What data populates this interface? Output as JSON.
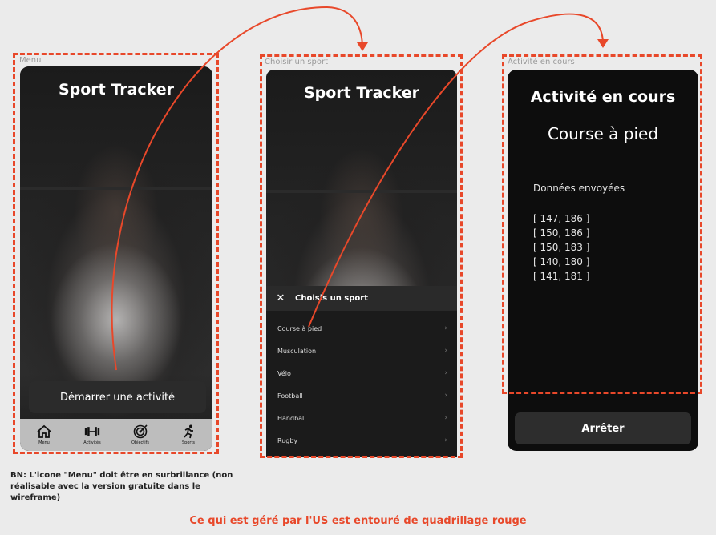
{
  "frames": {
    "menu": "Menu",
    "choose": "Choisir un sport",
    "activity": "Activité en cours"
  },
  "menu_screen": {
    "app_title": "Sport Tracker",
    "start_button": "Démarrer une activité",
    "tabs": [
      {
        "label": "Menu",
        "icon": "home-icon"
      },
      {
        "label": "Activités",
        "icon": "dumbbell-icon"
      },
      {
        "label": "Objectifs",
        "icon": "target-icon"
      },
      {
        "label": "Sports",
        "icon": "runner-icon"
      }
    ]
  },
  "choose_screen": {
    "app_title": "Sport Tracker",
    "sheet_title": "Choisis un sport",
    "close_icon": "close-icon",
    "sports": [
      "Course à pied",
      "Musculation",
      "Vélo",
      "Football",
      "Handball",
      "Rugby"
    ]
  },
  "activity_screen": {
    "title": "Activité en cours",
    "sport": "Course à pied",
    "data_label": "Données envoyées",
    "data_points": [
      "[ 147, 186 ]",
      "[ 150, 186 ]",
      "[ 150, 183 ]",
      "[ 140, 180 ]",
      "[ 141, 181 ]"
    ],
    "stop_button": "Arrêter"
  },
  "note": "BN: L'icone \"Menu\" doit être en surbrillance (non réalisable avec la version gratuite dans le wireframe)",
  "footer": "Ce qui est géré par l'US est entouré de quadrillage rouge",
  "colors": {
    "accent": "#e8482a",
    "screen_bg": "#111111",
    "tabbar": "#bdbdbd"
  }
}
